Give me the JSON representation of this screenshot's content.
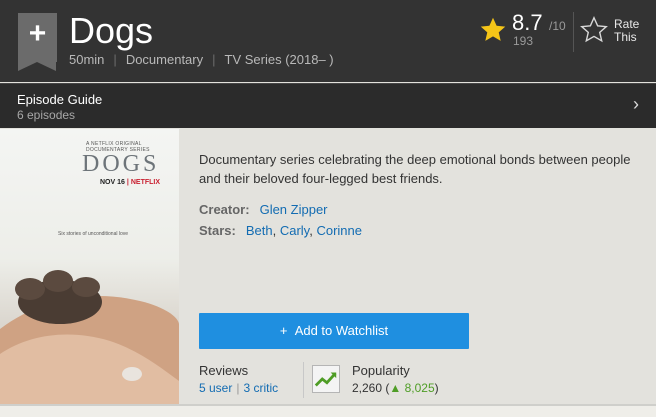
{
  "header": {
    "title": "Dogs",
    "runtime": "50min",
    "genre": "Documentary",
    "type": "TV Series (2018– )",
    "rating": {
      "value": "8.7",
      "out_of": "/10",
      "count": "193"
    },
    "rate_label_line1": "Rate",
    "rate_label_line2": "This",
    "bookmark_icon": "plus-icon"
  },
  "episode_guide": {
    "title": "Episode Guide",
    "count": "6 episodes"
  },
  "poster": {
    "small_text": "A NETFLIX ORIGINAL DOCUMENTARY SERIES",
    "title": "DOGS",
    "date": "NOV 16",
    "brand": "NETFLIX",
    "tagline": "Six stories of unconditional love"
  },
  "overview": {
    "description": "Documentary series celebrating the deep emotional bonds between people and their beloved four-legged best friends.",
    "creator_label": "Creator:",
    "creator": "Glen Zipper",
    "stars_label": "Stars:",
    "stars": [
      "Beth",
      "Carly",
      "Corinne"
    ]
  },
  "watchlist": {
    "label": "Add to Watchlist"
  },
  "reviews": {
    "label": "Reviews",
    "user": "5 user",
    "critic": "3 critic"
  },
  "popularity": {
    "label": "Popularity",
    "value": "2,260",
    "change": "8,025"
  },
  "colors": {
    "accent": "#1f8fe0",
    "link": "#136cb2",
    "star": "#f5c518",
    "trend_up": "#4f9d26",
    "header_bg": "#333333"
  }
}
